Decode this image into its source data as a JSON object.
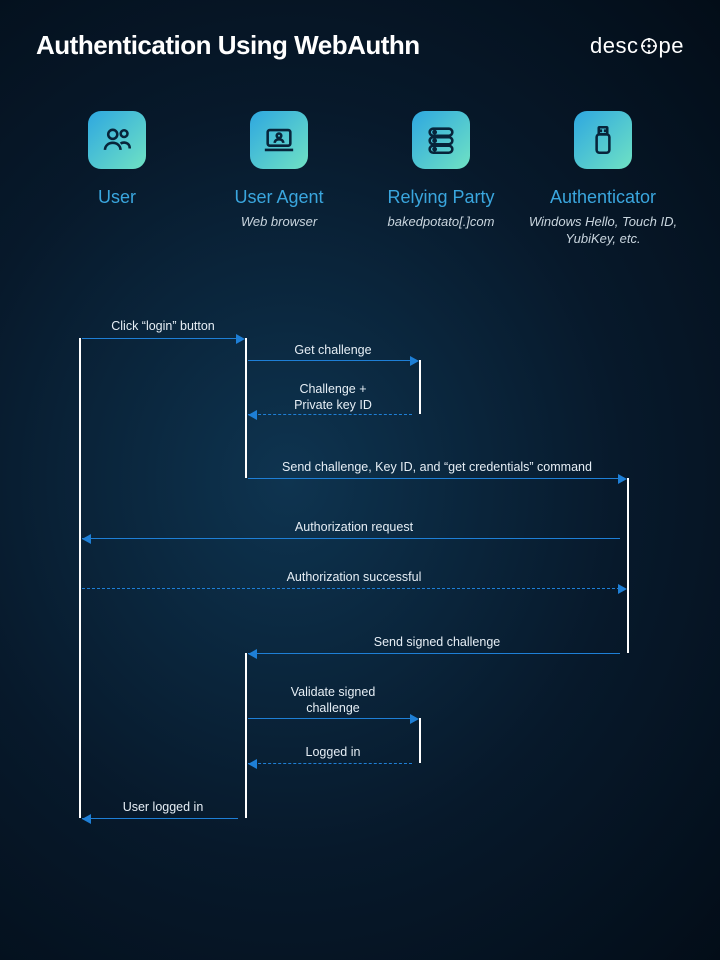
{
  "title": "Authentication Using WebAuthn",
  "brand": {
    "pre": "desc",
    "post": "pe"
  },
  "participants": [
    {
      "name": "User",
      "sub": "",
      "icon": "users-icon"
    },
    {
      "name": "User Agent",
      "sub": "Web browser",
      "icon": "laptop-icon"
    },
    {
      "name": "Relying Party",
      "sub": "bakedpotato[.]com",
      "icon": "server-icon"
    },
    {
      "name": "Authenticator",
      "sub": "Windows Hello, Touch ID, YubiKey, etc.",
      "icon": "usb-icon"
    }
  ],
  "messages": {
    "m1": "Click “login” button",
    "m2": "Get challenge",
    "m3": "Challenge +\nPrivate key ID",
    "m4": "Send challenge, Key ID, and “get credentials” command",
    "m5": "Authorization request",
    "m6": "Authorization successful",
    "m7": "Send signed challenge",
    "m8": "Validate signed\nchallenge",
    "m9": "Logged in",
    "m10": "User logged in"
  },
  "colors": {
    "accent": "#1e7fd6",
    "tile_from": "#2ea7e0",
    "tile_to": "#6fe2c4"
  },
  "lanes_x": {
    "user": 80,
    "agent": 246,
    "rp": 420,
    "auth": 628
  },
  "sequence": [
    {
      "from": "user",
      "to": "agent",
      "label_key": "m1",
      "style": "solid"
    },
    {
      "from": "agent",
      "to": "rp",
      "label_key": "m2",
      "style": "solid"
    },
    {
      "from": "rp",
      "to": "agent",
      "label_key": "m3",
      "style": "dashed"
    },
    {
      "from": "agent",
      "to": "auth",
      "label_key": "m4",
      "style": "solid"
    },
    {
      "from": "auth",
      "to": "user",
      "label_key": "m5",
      "style": "solid"
    },
    {
      "from": "user",
      "to": "auth",
      "label_key": "m6",
      "style": "dashed"
    },
    {
      "from": "auth",
      "to": "agent",
      "label_key": "m7",
      "style": "solid"
    },
    {
      "from": "agent",
      "to": "rp",
      "label_key": "m8",
      "style": "solid"
    },
    {
      "from": "rp",
      "to": "agent",
      "label_key": "m9",
      "style": "dashed"
    },
    {
      "from": "agent",
      "to": "user",
      "label_key": "m10",
      "style": "solid"
    }
  ]
}
